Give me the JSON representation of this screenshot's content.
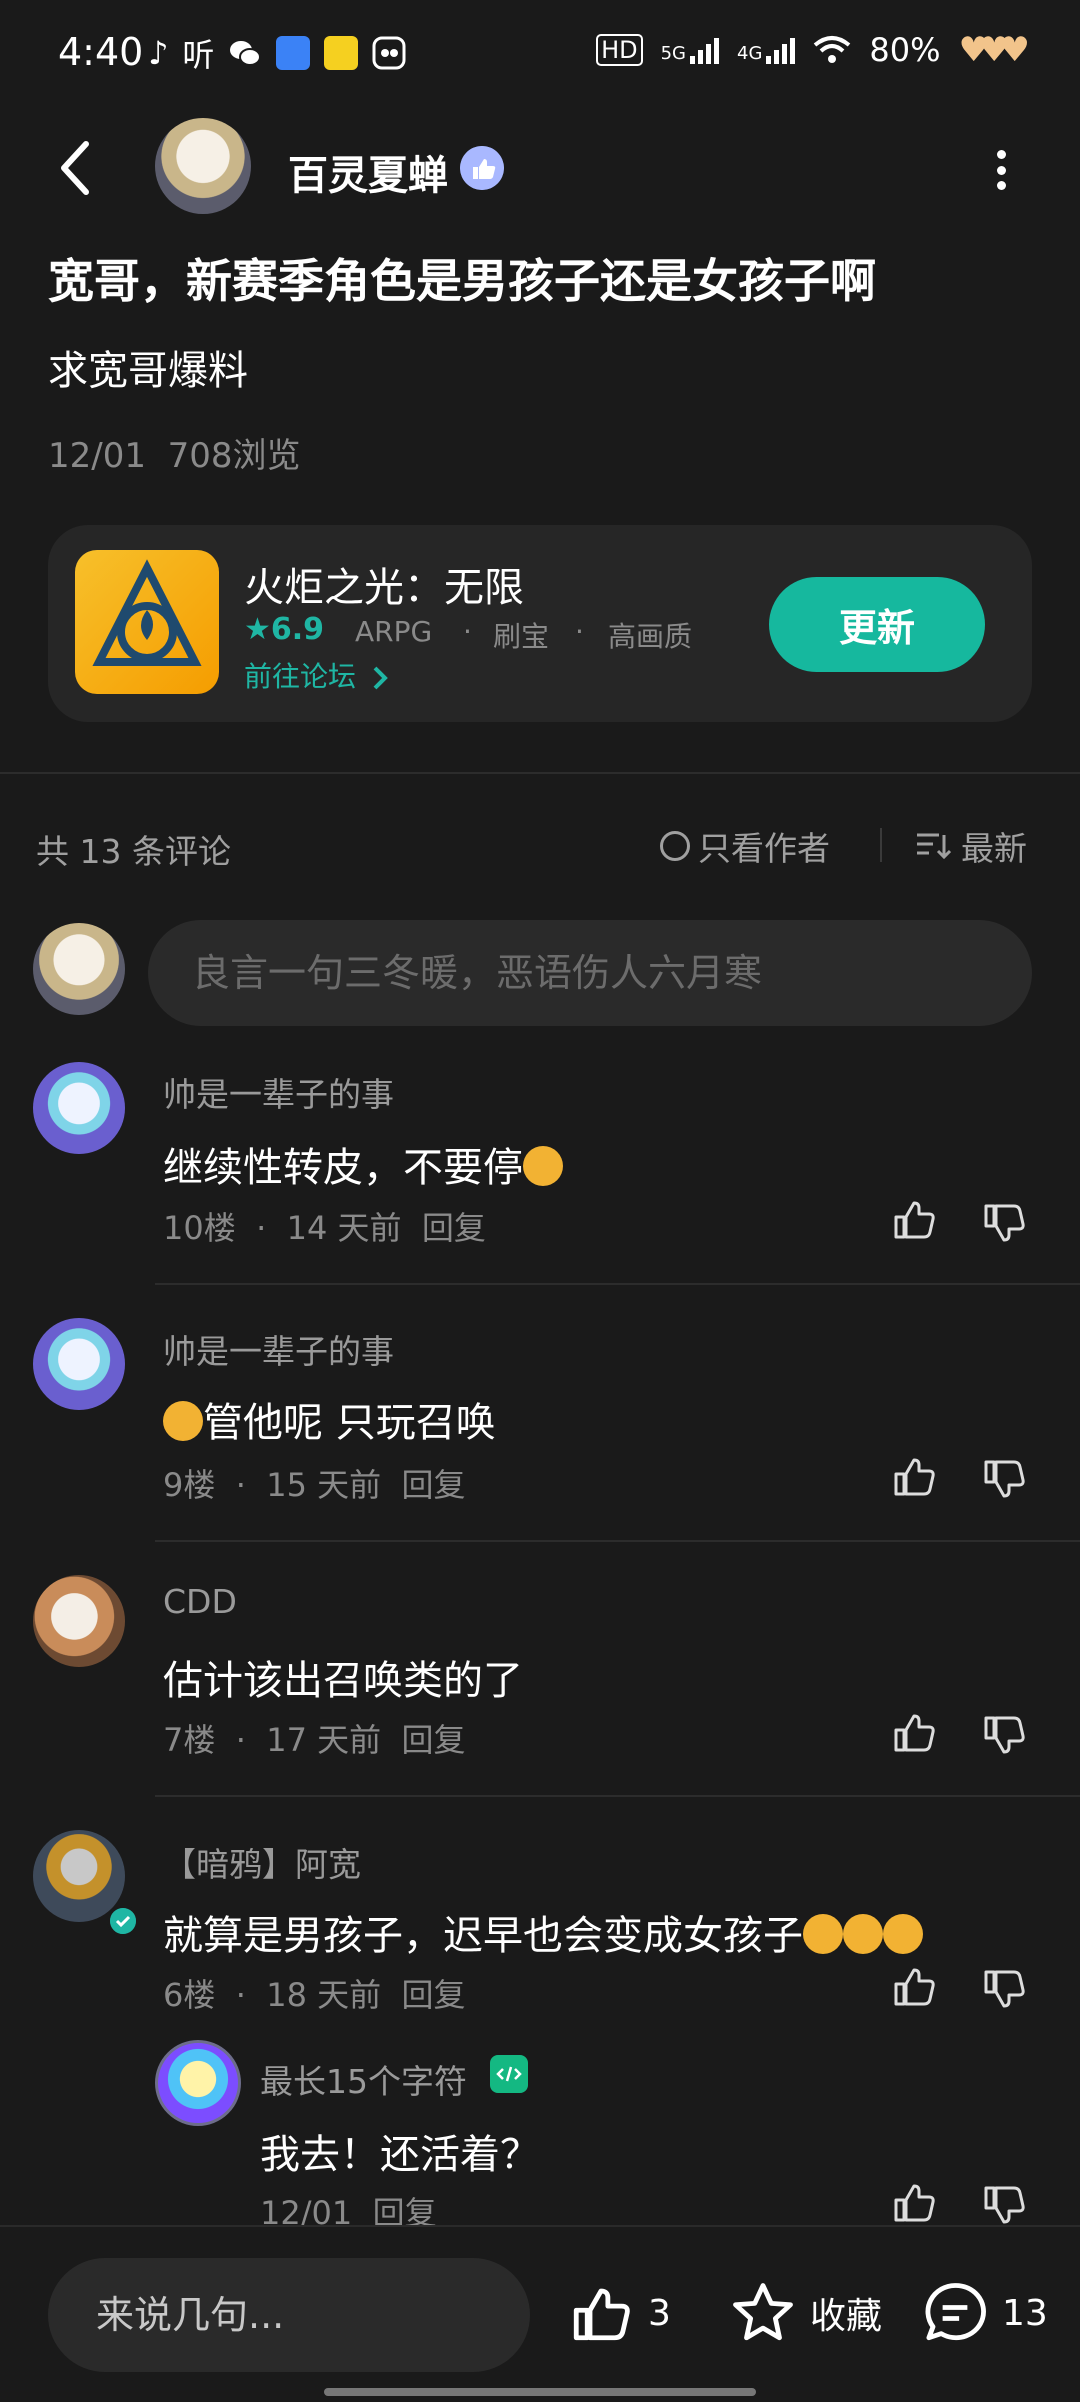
{
  "status": {
    "time": "4:40",
    "left_glyphs": [
      "♪",
      "听"
    ],
    "hd": "HD",
    "net1": "5G",
    "net2": "4G",
    "battery": "80%",
    "hearts": "♥♥♥"
  },
  "header": {
    "author": "百灵夏蝉",
    "back_icon": "back-arrow-icon",
    "more_icon": "more-vertical-icon"
  },
  "post": {
    "title": "宽哥，新赛季角色是男孩子还是女孩子啊",
    "body": "求宽哥爆料",
    "date": "12/01",
    "views": "708浏览"
  },
  "game": {
    "name": "火炬之光：无限",
    "rating": "6.9",
    "tags": [
      "ARPG",
      "刷宝",
      "高画质"
    ],
    "forum_link": "前往论坛",
    "button": "更新",
    "accent": "#16b89e"
  },
  "comments_header": {
    "count": "共 13 条评论",
    "author_only": "只看作者",
    "sort": "最新"
  },
  "comment_input": {
    "placeholder": "良言一句三冬暖，恶语伤人六月寒"
  },
  "comments": [
    {
      "user": "帅是一辈子的事",
      "text": "继续性转皮，不要停",
      "floor": "10楼",
      "time": "14 天前",
      "reply": "回复"
    },
    {
      "user": "帅是一辈子的事",
      "text": "管他呢 只玩召唤",
      "floor": "9楼",
      "time": "15 天前",
      "reply": "回复"
    },
    {
      "user": "CDD",
      "text": "估计该出召唤类的了",
      "floor": "7楼",
      "time": "17 天前",
      "reply": "回复"
    },
    {
      "user": "【暗鸦】阿宽",
      "text": "就算是男孩子，迟早也会变成女孩子",
      "floor": "6楼",
      "time": "18 天前",
      "reply": "回复"
    }
  ],
  "nested_reply": {
    "user": "最长15个字符",
    "text": "我去！还活着？",
    "date": "12/01",
    "reply": "回复"
  },
  "bottom": {
    "placeholder": "来说几句...",
    "likes": "3",
    "favorite": "收藏",
    "comments": "13"
  }
}
